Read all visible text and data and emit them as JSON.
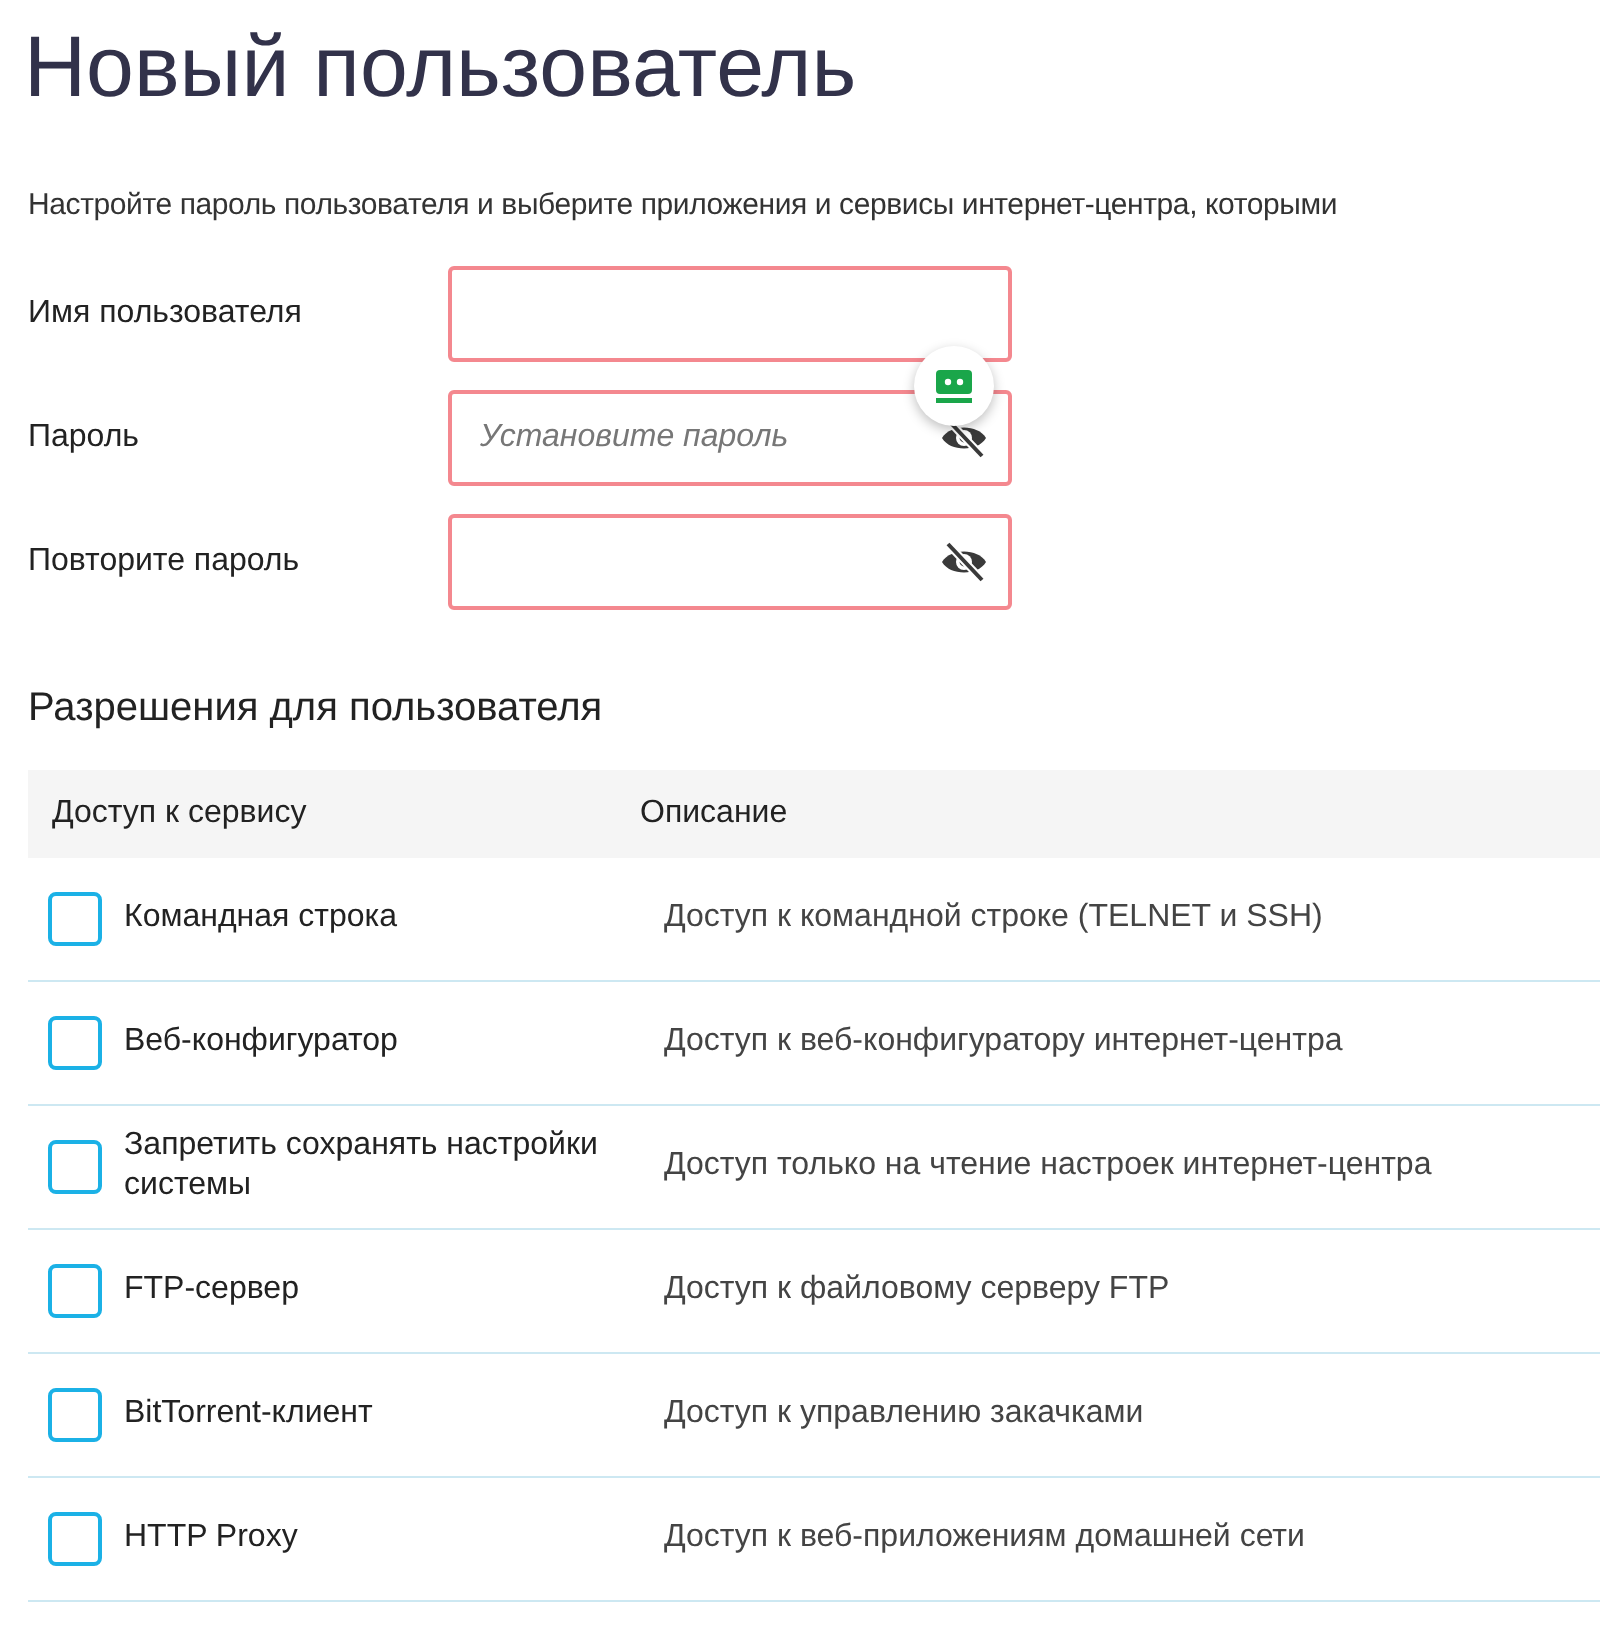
{
  "title": "Новый пользователь",
  "intro": "Настройте пароль пользователя и выберите приложения и сервисы интернет-центра, которыми",
  "fields": [
    {
      "label": "Имя пользователя",
      "kind": "text",
      "invalid": true
    },
    {
      "label": "Пароль",
      "kind": "password",
      "placeholder": "Установите пароль",
      "invalid": true
    },
    {
      "label": "Повторите пароль",
      "kind": "password",
      "invalid": true
    }
  ],
  "permissions": {
    "heading": "Разрешения для пользователя",
    "columns": [
      "Доступ к сервису",
      "Описание"
    ],
    "rows": [
      {
        "service": "Командная строка",
        "description": "Доступ к командной строке (TELNET и SSH)",
        "checked": false
      },
      {
        "service": "Веб-конфигуратор",
        "description": "Доступ к веб-конфигуратору интернет-центра",
        "checked": false
      },
      {
        "service": "Запретить сохранять настройки системы",
        "description": "Доступ только на чтение настроек интернет-центра",
        "checked": false
      },
      {
        "service": "FTP-сервер",
        "description": "Доступ к файловому серверу FTP",
        "checked": false
      },
      {
        "service": "BitTorrent-клиент",
        "description": "Доступ к управлению закачками",
        "checked": false
      },
      {
        "service": "HTTP Proxy",
        "description": "Доступ к веб-приложениям домашней сети",
        "checked": false
      }
    ]
  }
}
